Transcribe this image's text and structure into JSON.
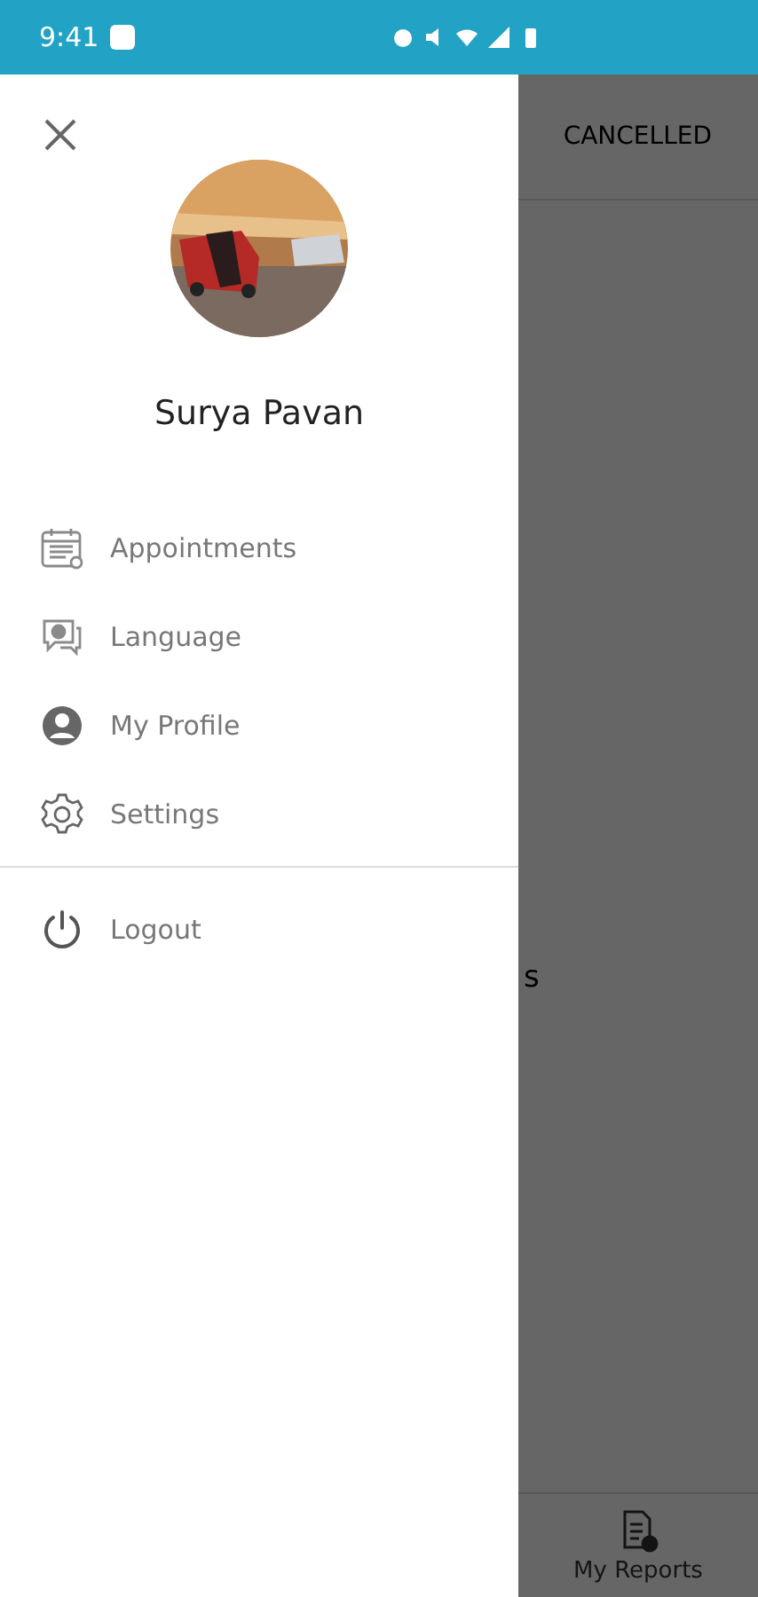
{
  "status_bar": {
    "time": "9:41"
  },
  "background": {
    "tab": "CANCELLED",
    "fragment": "s",
    "bottom_nav": {
      "label": "My Reports"
    }
  },
  "drawer": {
    "user_name": "Surya Pavan",
    "items": [
      {
        "kind": "calendar",
        "label": "Appointments"
      },
      {
        "kind": "chat",
        "label": "Language"
      },
      {
        "kind": "person",
        "label": "My Profile"
      },
      {
        "kind": "gear",
        "label": "Settings"
      }
    ],
    "footer_items": [
      {
        "kind": "power",
        "label": "Logout"
      }
    ]
  }
}
